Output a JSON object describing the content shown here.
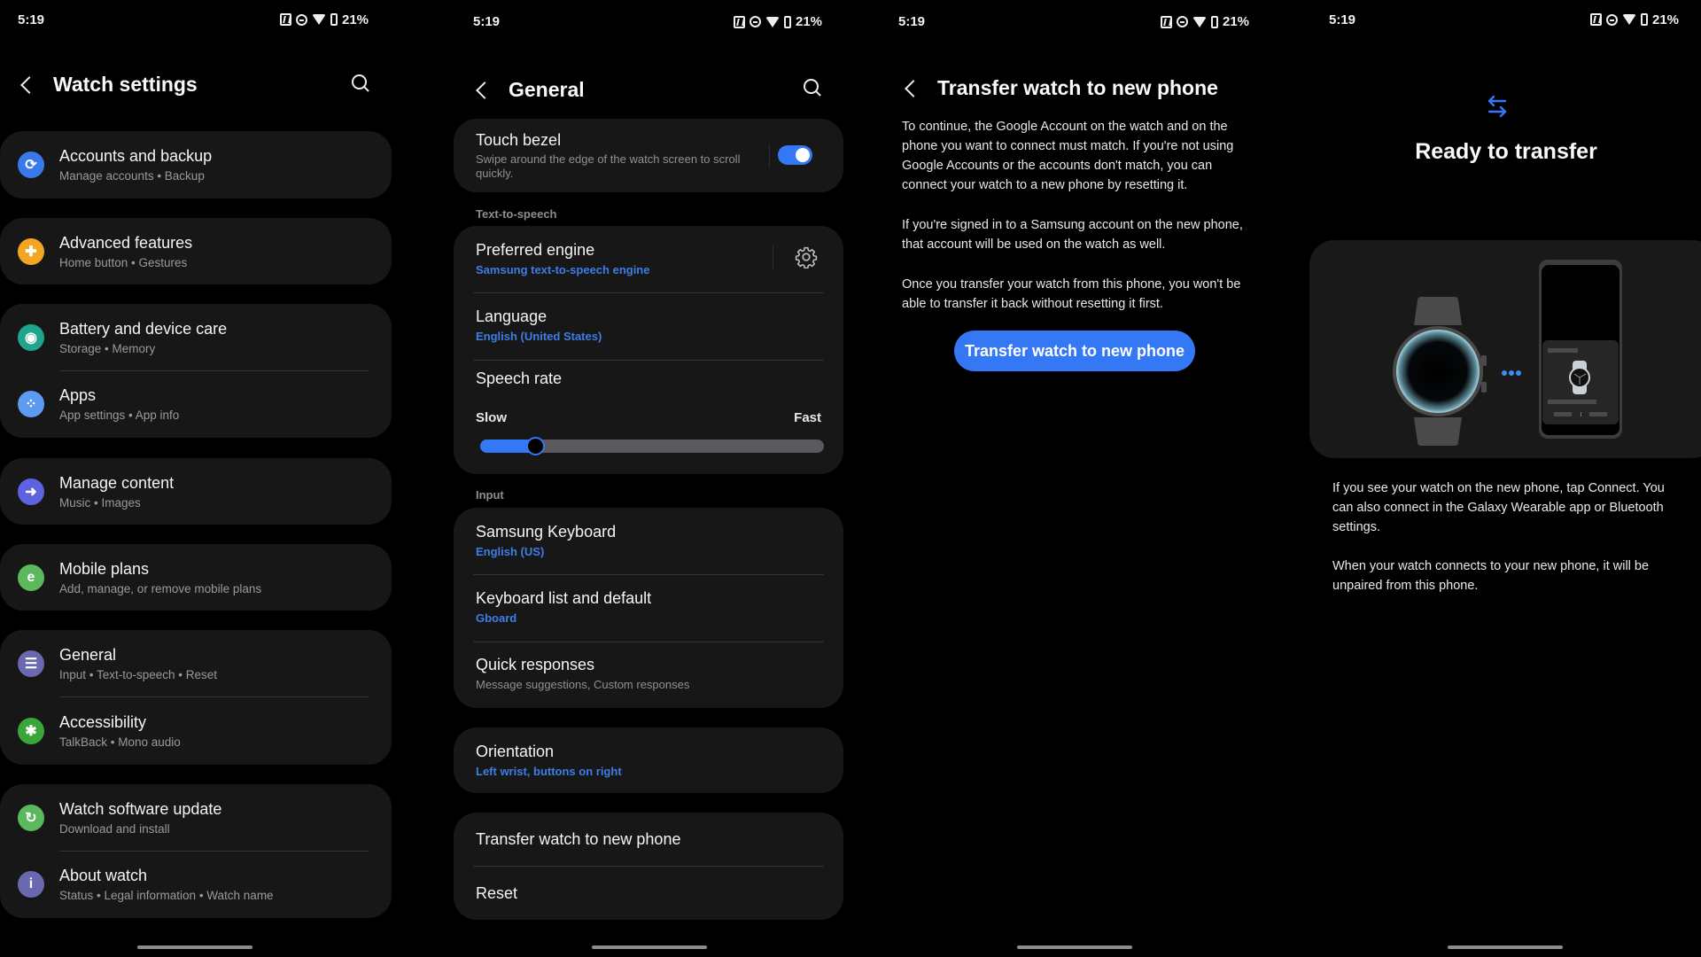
{
  "status_bar": {
    "time": "5:19",
    "battery": "21%",
    "icons": [
      "nfc-icon",
      "do-not-disturb-icon",
      "wifi-icon",
      "battery-icon"
    ]
  },
  "watch_settings": {
    "title": "Watch settings",
    "items": [
      {
        "label": "Accounts and backup",
        "sub": "Manage accounts • Backup",
        "icon": "sync-icon",
        "color": "#3a79ec",
        "glyph": "⟳"
      },
      {
        "label": "Advanced features",
        "sub": "Home button • Gestures",
        "icon": "gear-plus-icon",
        "color": "#f4a623",
        "glyph": "✚"
      },
      {
        "label": "Battery and device care",
        "sub": "Storage • Memory",
        "icon": "device-care-icon",
        "color": "#1ea58c",
        "glyph": "◉"
      },
      {
        "label": "Apps",
        "sub": "App settings • App info",
        "icon": "apps-icon",
        "color": "#5b9bf0",
        "glyph": "⁘"
      },
      {
        "label": "Manage content",
        "sub": "Music • Images",
        "icon": "folder-icon",
        "color": "#5d63e0",
        "glyph": "➜"
      },
      {
        "label": "Mobile plans",
        "sub": "Add, manage, or remove mobile plans",
        "icon": "esim-icon",
        "color": "#5cb85c",
        "glyph": "e"
      },
      {
        "label": "General",
        "sub": "Input • Text-to-speech • Reset",
        "icon": "sliders-icon",
        "color": "#6a68b0",
        "glyph": "☰"
      },
      {
        "label": "Accessibility",
        "sub": "TalkBack • Mono audio",
        "icon": "accessibility-icon",
        "color": "#3aa63a",
        "glyph": "✱"
      },
      {
        "label": "Watch software update",
        "sub": "Download and install",
        "icon": "watch-update-icon",
        "color": "#5cb85c",
        "glyph": "↻"
      },
      {
        "label": "About watch",
        "sub": "Status • Legal information • Watch name",
        "icon": "info-icon",
        "color": "#6a68b0",
        "glyph": "i"
      }
    ]
  },
  "general": {
    "title": "General",
    "touch_bezel": {
      "label": "Touch bezel",
      "sub": "Swipe around the edge of the watch screen to scroll quickly.",
      "enabled": true
    },
    "tts_section": "Text-to-speech",
    "preferred_engine": {
      "label": "Preferred engine",
      "value": "Samsung text-to-speech engine"
    },
    "language": {
      "label": "Language",
      "value": "English (United States)"
    },
    "speech_rate": {
      "label": "Speech rate",
      "min_label": "Slow",
      "max_label": "Fast",
      "value_fraction": 0.16
    },
    "input_section": "Input",
    "samsung_keyboard": {
      "label": "Samsung Keyboard",
      "value": "English (US)"
    },
    "keyboard_list": {
      "label": "Keyboard list and default",
      "value": "Gboard"
    },
    "quick_responses": {
      "label": "Quick responses",
      "sub": "Message suggestions, Custom responses"
    },
    "orientation": {
      "label": "Orientation",
      "value": "Left wrist, buttons on right"
    },
    "transfer": {
      "label": "Transfer watch to new phone"
    },
    "reset": {
      "label": "Reset"
    }
  },
  "transfer_page": {
    "title": "Transfer watch to new phone",
    "paragraphs": [
      "To continue, the Google Account on the watch and on the phone you want to connect must match. If you're not using Google Accounts or the accounts don't match, you can connect your watch to a new phone by resetting it.",
      "If you're signed in to a Samsung account on the new phone, that account will be used on the watch as well.",
      "Once you transfer your watch from this phone, you won't be able to transfer it back without resetting it first."
    ],
    "button": "Transfer watch to new phone"
  },
  "ready_page": {
    "title": "Ready to transfer",
    "paragraphs": [
      "If you see your watch on the new phone, tap Connect. You can also connect in the Galaxy Wearable app or Bluetooth settings.",
      "When your watch connects to your new phone, it will be unpaired from this phone."
    ]
  },
  "colors": {
    "accent": "#3478f6",
    "link": "#3d7ee6",
    "card": "#171717",
    "background": "#000000"
  }
}
